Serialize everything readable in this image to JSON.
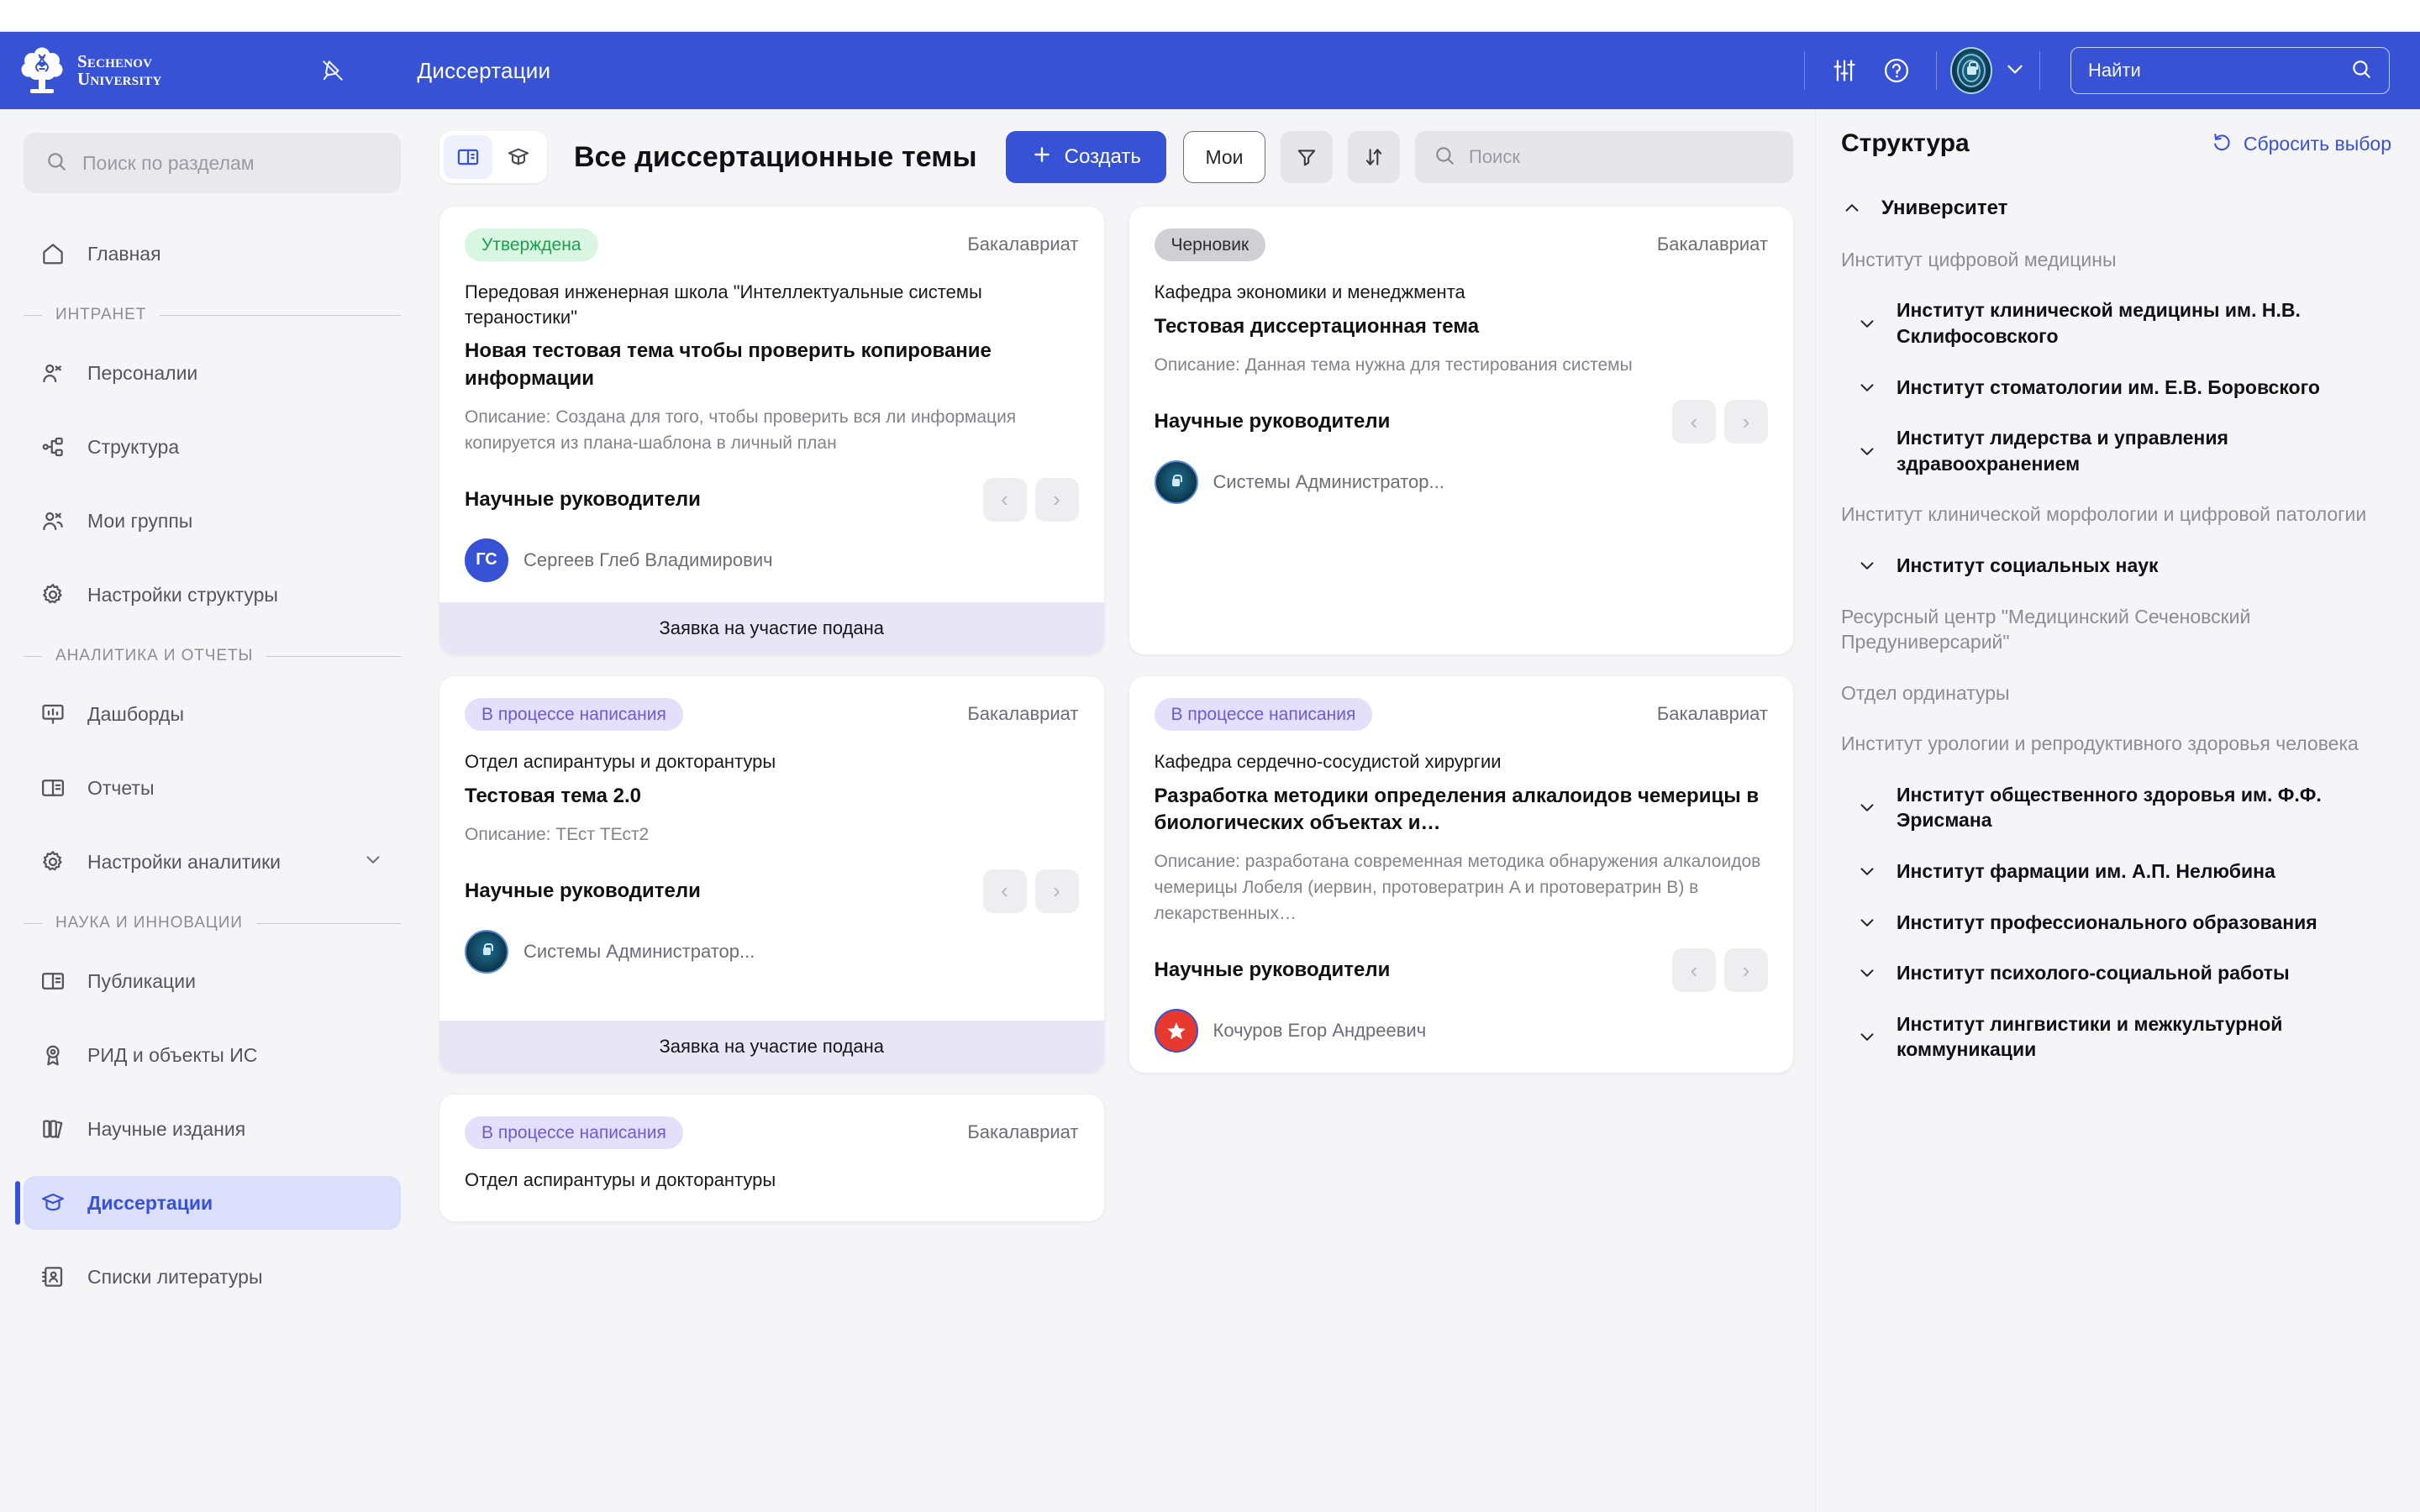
{
  "header": {
    "brand_line1": "Sechenov",
    "brand_line2": "University",
    "pin_icon": "pin-off-icon",
    "title": "Диссертации",
    "settings_icon": "sliders-icon",
    "help_icon": "help-circle-icon",
    "avatar_icon": "fingerprint-lock-avatar",
    "chevron_icon": "chevron-down-icon",
    "search_placeholder": "Найти",
    "search_icon": "search-icon",
    "accent_color": "#3852d6"
  },
  "sidebar": {
    "search_placeholder": "Поиск по разделам",
    "search_icon": "search-icon",
    "items": [
      {
        "label": "Главная",
        "icon": "home-icon",
        "type": "item"
      },
      {
        "label": "ИНТРАНЕТ",
        "type": "group"
      },
      {
        "label": "Персоналии",
        "icon": "users-icon",
        "type": "item"
      },
      {
        "label": "Структура",
        "icon": "sitemap-icon",
        "type": "item"
      },
      {
        "label": "Мои группы",
        "icon": "user-group-icon",
        "type": "item"
      },
      {
        "label": "Настройки структуры",
        "icon": "gear-icon",
        "type": "item"
      },
      {
        "label": "АНАЛИТИКА И ОТЧЕТЫ",
        "type": "group"
      },
      {
        "label": "Дашборды",
        "icon": "dashboard-icon",
        "type": "item"
      },
      {
        "label": "Отчеты",
        "icon": "book-open-icon",
        "type": "item"
      },
      {
        "label": "Настройки аналитики",
        "icon": "gear-icon",
        "type": "item",
        "chevron": true
      },
      {
        "label": "НАУКА И ИННОВАЦИИ",
        "type": "group"
      },
      {
        "label": "Публикации",
        "icon": "book-open-icon",
        "type": "item"
      },
      {
        "label": "РИД и объекты ИС",
        "icon": "award-icon",
        "type": "item"
      },
      {
        "label": "Научные издания",
        "icon": "books-icon",
        "type": "item"
      },
      {
        "label": "Диссертации",
        "icon": "graduation-cap-icon",
        "type": "item",
        "active": true
      },
      {
        "label": "Списки литературы",
        "icon": "contact-book-icon",
        "type": "item"
      }
    ]
  },
  "toolbar": {
    "view_book_icon": "book-open-icon",
    "view_cap_icon": "graduation-cap-icon",
    "page_title": "Все диссертационные темы",
    "create_label": "Создать",
    "create_icon": "plus-icon",
    "mine_label": "Мои",
    "filter_icon": "filter-icon",
    "sort_icon": "sort-icon",
    "search_placeholder": "Поиск",
    "search_icon": "search-icon"
  },
  "cards": [
    {
      "status": "Утверждена",
      "status_kind": "approved",
      "degree": "Бакалавриат",
      "department": "Передовая инженерная школа \"Интеллектуальные системы тераностики\"",
      "title": "Новая тестовая тема чтобы проверить копирование информации",
      "description": "Описание: Создана для того, чтобы проверить вся ли информация копируется из плана-шаблона в личный план",
      "supervisors_label": "Научные руководители",
      "prev_icon": "chevron-left-icon",
      "next_icon": "chevron-right-icon",
      "supervisor_name": "Сергеев Глеб Владимирович",
      "supervisor_avatar": "ГС",
      "avatar_kind": "initials",
      "footer": "Заявка на участие подана"
    },
    {
      "status": "Черновик",
      "status_kind": "draft",
      "degree": "Бакалавриат",
      "department": "Кафедра экономики и менеджмента",
      "title": "Тестовая диссертационная тема",
      "description": "Описание: Данная тема нужна для тестирования системы",
      "supervisors_label": "Научные руководители",
      "prev_icon": "chevron-left-icon",
      "next_icon": "chevron-right-icon",
      "supervisor_name": "Системы Администратор...",
      "supervisor_avatar": "",
      "avatar_kind": "fp",
      "footer": ""
    },
    {
      "status": "В процессе написания",
      "status_kind": "writing",
      "degree": "Бакалавриат",
      "department": "Отдел аспирантуры и докторантуры",
      "title": "Тестовая тема 2.0",
      "description": "Описание: ТЕст ТЕст2",
      "supervisors_label": "Научные руководители",
      "prev_icon": "chevron-left-icon",
      "next_icon": "chevron-right-icon",
      "supervisor_name": "Системы Администратор...",
      "supervisor_avatar": "",
      "avatar_kind": "fp",
      "footer": "Заявка на участие подана"
    },
    {
      "status": "В процессе написания",
      "status_kind": "writing",
      "degree": "Бакалавриат",
      "department": "Кафедра сердечно-сосудистой хирургии",
      "title": "Разработка методики определения алкалоидов чемерицы в биологических объектах и…",
      "description": "Описание: разработана современная методика обнаружения алкалоидов чемерицы Лобеля (иервин, протовератрин A и протовератрин B) в лекарственных…",
      "supervisors_label": "Научные руководители",
      "prev_icon": "chevron-left-icon",
      "next_icon": "chevron-right-icon",
      "supervisor_name": "Кочуров Егор Андреевич",
      "supervisor_avatar": "",
      "avatar_kind": "star",
      "footer": ""
    },
    {
      "status": "В процессе написания",
      "status_kind": "writing",
      "degree": "Бакалавриат",
      "department": "Отдел аспирантуры и докторантуры",
      "title": "",
      "description": "",
      "supervisors_label": "",
      "prev_icon": "chevron-left-icon",
      "next_icon": "chevron-right-icon",
      "supervisor_name": "",
      "supervisor_avatar": "",
      "avatar_kind": "none",
      "footer": ""
    }
  ],
  "structure": {
    "title": "Структура",
    "reset_label": "Сбросить выбор",
    "reset_icon": "undo-icon",
    "nodes": [
      {
        "label": "Университет",
        "kind": "root",
        "chevron": "chevron-up-icon"
      },
      {
        "label": "Институт цифровой медицины",
        "kind": "leaf"
      },
      {
        "label": "Институт клинической медицины им. Н.В. Склифосовского",
        "kind": "node",
        "chevron": "chevron-down-icon"
      },
      {
        "label": "Институт стоматологии им. Е.В. Боровского",
        "kind": "node",
        "chevron": "chevron-down-icon"
      },
      {
        "label": "Институт лидерства и управления здравоохранением",
        "kind": "node",
        "chevron": "chevron-down-icon"
      },
      {
        "label": "Институт клинической морфологии и цифровой патологии",
        "kind": "leaf"
      },
      {
        "label": "Институт социальных наук",
        "kind": "node",
        "chevron": "chevron-down-icon"
      },
      {
        "label": "Ресурсный центр \"Медицинский Сеченовский Предуниверсарий\"",
        "kind": "leaf"
      },
      {
        "label": "Отдел ординатуры",
        "kind": "leaf"
      },
      {
        "label": "Институт урологии и репродуктивного здоровья человека",
        "kind": "leaf"
      },
      {
        "label": "Институт общественного здоровья им. Ф.Ф. Эрисмана",
        "kind": "node",
        "chevron": "chevron-down-icon"
      },
      {
        "label": "Институт фармации им. А.П. Нелюбина",
        "kind": "node",
        "chevron": "chevron-down-icon"
      },
      {
        "label": "Институт профессионального образования",
        "kind": "node",
        "chevron": "chevron-down-icon"
      },
      {
        "label": "Институт психолого-социальной работы",
        "kind": "node",
        "chevron": "chevron-down-icon"
      },
      {
        "label": "Институт лингвистики и межкультурной коммуникации",
        "kind": "node",
        "chevron": "chevron-down-icon"
      }
    ]
  }
}
